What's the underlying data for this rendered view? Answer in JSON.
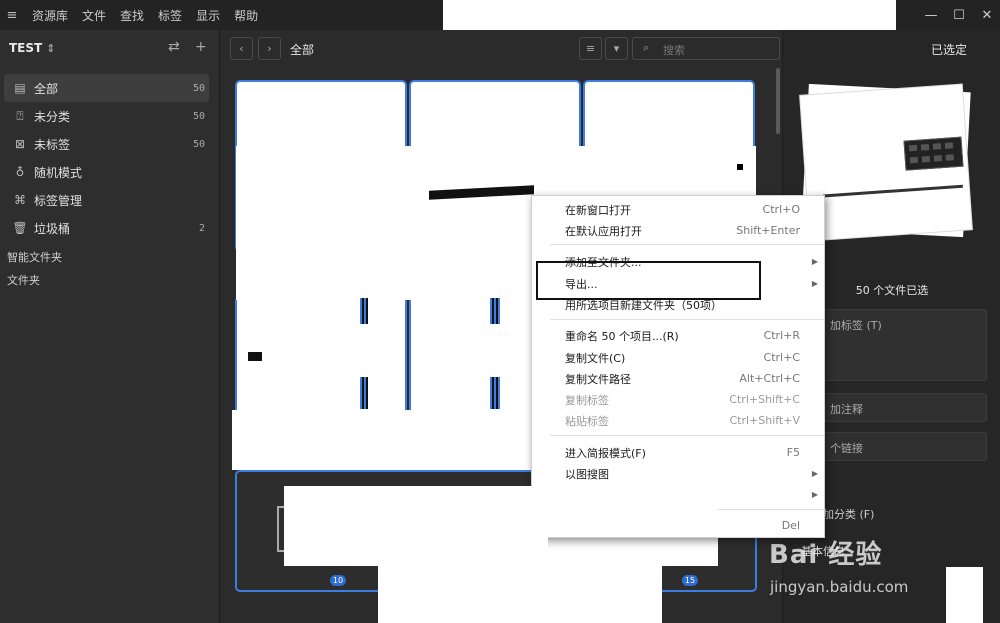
{
  "menubar": {
    "items": [
      "资源库",
      "文件",
      "查找",
      "标签",
      "显示",
      "帮助"
    ]
  },
  "sidebar": {
    "library_name": "TEST",
    "items": [
      {
        "label": "全部",
        "count": "50"
      },
      {
        "label": "未分类",
        "count": "50"
      },
      {
        "label": "未标签",
        "count": "50"
      },
      {
        "label": "随机模式",
        "count": ""
      },
      {
        "label": "标签管理",
        "count": ""
      },
      {
        "label": "垃圾桶",
        "count": "2"
      }
    ],
    "sections": [
      "智能文件夹",
      "文件夹"
    ]
  },
  "main": {
    "breadcrumb": "全部",
    "search_placeholder": "搜索"
  },
  "grid": {
    "badges": [
      "10",
      "15"
    ]
  },
  "inspector": {
    "tab_selected": "已选定",
    "selected_count": "50 个文件已选",
    "fields": {
      "add_tag": "加标签 (T)",
      "add_note": "加注释",
      "add_link": "个链接",
      "add_category": "加分类 (F)",
      "basic_info": "基本信息"
    }
  },
  "context_menu": {
    "items": [
      {
        "label": "在新窗口打开",
        "shortcut": "Ctrl+O"
      },
      {
        "label": "在默认应用打开",
        "shortcut": "Shift+Enter"
      },
      {
        "label": "添加至文件夹...",
        "shortcut": "",
        "submenu": true
      },
      {
        "label": "导出...",
        "shortcut": "",
        "submenu": true
      },
      {
        "label": "用所选项目新建文件夹（50项）",
        "shortcut": ""
      },
      {
        "label": "重命名 50 个项目...(R)",
        "shortcut": "Ctrl+R"
      },
      {
        "label": "复制文件(C)",
        "shortcut": "Ctrl+C"
      },
      {
        "label": "复制文件路径",
        "shortcut": "Alt+Ctrl+C"
      },
      {
        "label": "复制标签",
        "shortcut": "Ctrl+Shift+C",
        "disabled": true
      },
      {
        "label": "粘贴标签",
        "shortcut": "Ctrl+Shift+V",
        "disabled": true
      },
      {
        "label": "进入简报模式(F)",
        "shortcut": "F5"
      },
      {
        "label": "以图搜图",
        "shortcut": "",
        "submenu": true
      },
      {
        "label": "",
        "shortcut": "",
        "submenu": true
      },
      {
        "label": "",
        "shortcut": "Del"
      }
    ]
  },
  "watermark": {
    "text": "Bai 经验",
    "url": "jingyan.baidu.com"
  }
}
